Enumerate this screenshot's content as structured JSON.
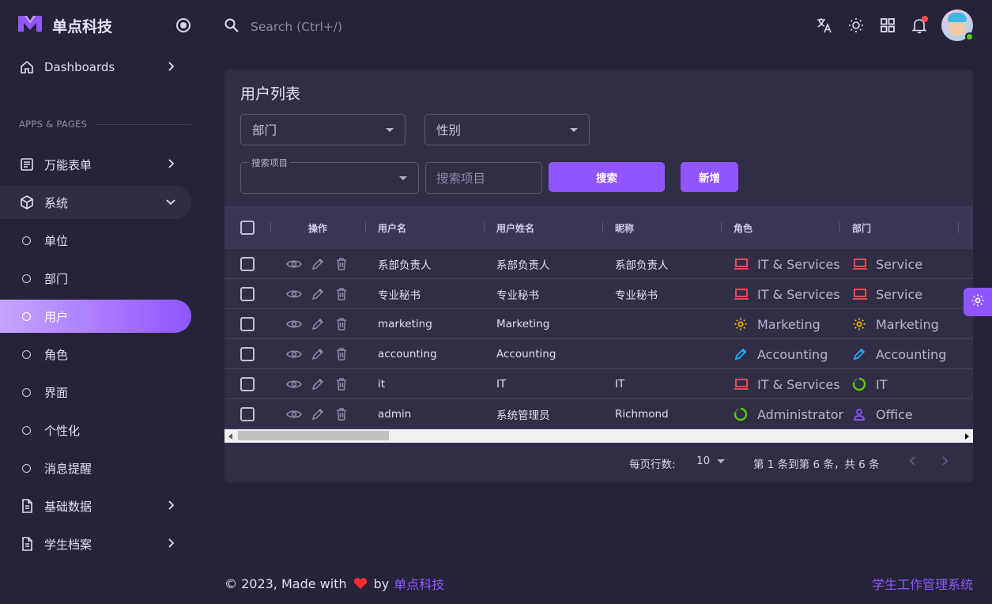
{
  "brand": {
    "name": "单点科技"
  },
  "sidebar": {
    "section_label": "APPS & PAGES",
    "dashboards": "Dashboards",
    "forms": "万能表单",
    "system": "系统",
    "sub": [
      "单位",
      "部门",
      "用户",
      "角色",
      "界面",
      "个性化",
      "消息提醒"
    ],
    "base_data": "基础数据",
    "student_files": "学生档案"
  },
  "topbar": {
    "search_placeholder": "Search (Ctrl+/)"
  },
  "card": {
    "title": "用户列表",
    "filter_dept": "部门",
    "filter_gender": "性别",
    "search_field_legend": "搜索项目",
    "search_input_placeholder": "搜索项目",
    "search_button": "搜索",
    "add_button": "新增"
  },
  "table": {
    "headers": [
      "操作",
      "用户名",
      "用户姓名",
      "昵称",
      "角色",
      "部门"
    ],
    "rows": [
      {
        "username": "系部负责人",
        "fullname": "系部负责人",
        "nickname": "系部负责人",
        "role": "IT & Services",
        "role_icon": "laptop-icon",
        "role_color": "#ff4c51",
        "dept": "Service",
        "dept_icon": "laptop-icon",
        "dept_color": "#ff4c51"
      },
      {
        "username": "专业秘书",
        "fullname": "专业秘书",
        "nickname": "专业秘书",
        "role": "IT & Services",
        "role_icon": "laptop-icon",
        "role_color": "#ff4c51",
        "dept": "Service",
        "dept_icon": "laptop-icon",
        "dept_color": "#ff4c51"
      },
      {
        "username": "marketing",
        "fullname": "Marketing",
        "nickname": "",
        "role": "Marketing",
        "role_icon": "cog-icon",
        "role_color": "#ffb400",
        "dept": "Marketing",
        "dept_icon": "cog-icon",
        "dept_color": "#ffb400"
      },
      {
        "username": "accounting",
        "fullname": "Accounting",
        "nickname": "",
        "role": "Accounting",
        "role_icon": "pencil-icon",
        "role_color": "#16b1ff",
        "dept": "Accounting",
        "dept_icon": "pencil-icon",
        "dept_color": "#16b1ff"
      },
      {
        "username": "it",
        "fullname": "IT",
        "nickname": "IT",
        "role": "IT & Services",
        "role_icon": "laptop-icon",
        "role_color": "#ff4c51",
        "dept": "IT",
        "dept_icon": "chart-donut-icon",
        "dept_color": "#56ca00"
      },
      {
        "username": "admin",
        "fullname": "系统管理员",
        "nickname": "Richmond",
        "role": "Administrator",
        "role_icon": "chart-donut-icon",
        "role_color": "#56ca00",
        "dept": "Office",
        "dept_icon": "user-icon",
        "dept_color": "#9155fd"
      }
    ]
  },
  "pagination": {
    "rows_per_page_label": "每页行数:",
    "rows_per_page": "10",
    "range_text": "第 1 条到第 6 条，共 6 条"
  },
  "footer": {
    "copyright": "© 2023, Made with",
    "by": "by",
    "company": "单点科技",
    "system_name": "学生工作管理系统"
  },
  "colors": {
    "accent": "#9155fd",
    "heart": "#ff4c51"
  }
}
